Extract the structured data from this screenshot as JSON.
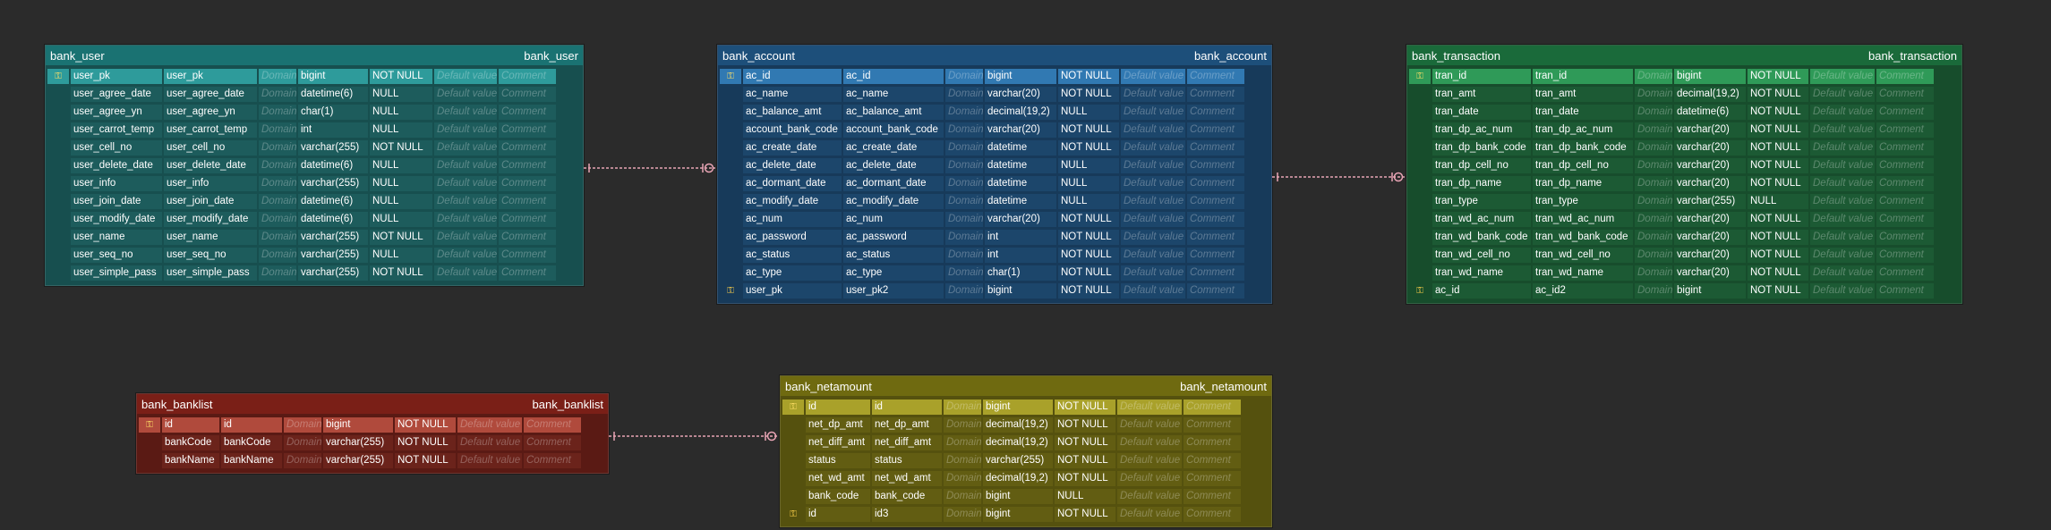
{
  "colors": {
    "background": "#2b2b2b",
    "relationship_line": "#e8a4b4"
  },
  "key_icons": {
    "primary": "⚿",
    "foreign": "⚿"
  },
  "tables": [
    {
      "id": "bank_user",
      "title": "bank_user",
      "title_right": "bank_user",
      "colors": {
        "header": "#1a7272",
        "body": "#174f4f",
        "pk": "#2e9b9b",
        "cell": "#1d5c5c"
      },
      "columns": [
        {
          "key": "pk",
          "name": "user_pk",
          "label": "user_pk",
          "domain": "Domain",
          "type": "bigint",
          "null": "NOT NULL",
          "default": "Default value",
          "comment": "Comment"
        },
        {
          "key": "",
          "name": "user_agree_date",
          "label": "user_agree_date",
          "domain": "Domain",
          "type": "datetime(6)",
          "null": "NULL",
          "default": "Default value",
          "comment": "Comment"
        },
        {
          "key": "",
          "name": "user_agree_yn",
          "label": "user_agree_yn",
          "domain": "Domain",
          "type": "char(1)",
          "null": "NULL",
          "default": "Default value",
          "comment": "Comment"
        },
        {
          "key": "",
          "name": "user_carrot_temp",
          "label": "user_carrot_temp",
          "domain": "Domain",
          "type": "int",
          "null": "NULL",
          "default": "Default value",
          "comment": "Comment"
        },
        {
          "key": "",
          "name": "user_cell_no",
          "label": "user_cell_no",
          "domain": "Domain",
          "type": "varchar(255)",
          "null": "NOT NULL",
          "default": "Default value",
          "comment": "Comment"
        },
        {
          "key": "",
          "name": "user_delete_date",
          "label": "user_delete_date",
          "domain": "Domain",
          "type": "datetime(6)",
          "null": "NULL",
          "default": "Default value",
          "comment": "Comment"
        },
        {
          "key": "",
          "name": "user_info",
          "label": "user_info",
          "domain": "Domain",
          "type": "varchar(255)",
          "null": "NULL",
          "default": "Default value",
          "comment": "Comment"
        },
        {
          "key": "",
          "name": "user_join_date",
          "label": "user_join_date",
          "domain": "Domain",
          "type": "datetime(6)",
          "null": "NULL",
          "default": "Default value",
          "comment": "Comment"
        },
        {
          "key": "",
          "name": "user_modify_date",
          "label": "user_modify_date",
          "domain": "Domain",
          "type": "datetime(6)",
          "null": "NULL",
          "default": "Default value",
          "comment": "Comment"
        },
        {
          "key": "",
          "name": "user_name",
          "label": "user_name",
          "domain": "Domain",
          "type": "varchar(255)",
          "null": "NOT NULL",
          "default": "Default value",
          "comment": "Comment"
        },
        {
          "key": "",
          "name": "user_seq_no",
          "label": "user_seq_no",
          "domain": "Domain",
          "type": "varchar(255)",
          "null": "NULL",
          "default": "Default value",
          "comment": "Comment"
        },
        {
          "key": "",
          "name": "user_simple_pass",
          "label": "user_simple_pass",
          "domain": "Domain",
          "type": "varchar(255)",
          "null": "NOT NULL",
          "default": "Default value",
          "comment": "Comment"
        }
      ]
    },
    {
      "id": "bank_account",
      "title": "bank_account",
      "title_right": "bank_account",
      "colors": {
        "header": "#1d4f7a",
        "body": "#173a5a",
        "pk": "#3179b2",
        "cell": "#1c466b"
      },
      "columns": [
        {
          "key": "pk",
          "name": "ac_id",
          "label": "ac_id",
          "domain": "Domain",
          "type": "bigint",
          "null": "NOT NULL",
          "default": "Default value",
          "comment": "Comment"
        },
        {
          "key": "",
          "name": "ac_name",
          "label": "ac_name",
          "domain": "Domain",
          "type": "varchar(20)",
          "null": "NOT NULL",
          "default": "Default value",
          "comment": "Comment"
        },
        {
          "key": "",
          "name": "ac_balance_amt",
          "label": "ac_balance_amt",
          "domain": "Domain",
          "type": "decimal(19,2)",
          "null": "NULL",
          "default": "Default value",
          "comment": "Comment"
        },
        {
          "key": "",
          "name": "account_bank_code",
          "label": "account_bank_code",
          "domain": "Domain",
          "type": "varchar(20)",
          "null": "NOT NULL",
          "default": "Default value",
          "comment": "Comment"
        },
        {
          "key": "",
          "name": "ac_create_date",
          "label": "ac_create_date",
          "domain": "Domain",
          "type": "datetime",
          "null": "NOT NULL",
          "default": "Default value",
          "comment": "Comment"
        },
        {
          "key": "",
          "name": "ac_delete_date",
          "label": "ac_delete_date",
          "domain": "Domain",
          "type": "datetime",
          "null": "NULL",
          "default": "Default value",
          "comment": "Comment"
        },
        {
          "key": "",
          "name": "ac_dormant_date",
          "label": "ac_dormant_date",
          "domain": "Domain",
          "type": "datetime",
          "null": "NULL",
          "default": "Default value",
          "comment": "Comment"
        },
        {
          "key": "",
          "name": "ac_modify_date",
          "label": "ac_modify_date",
          "domain": "Domain",
          "type": "datetime",
          "null": "NULL",
          "default": "Default value",
          "comment": "Comment"
        },
        {
          "key": "",
          "name": "ac_num",
          "label": "ac_num",
          "domain": "Domain",
          "type": "varchar(20)",
          "null": "NOT NULL",
          "default": "Default value",
          "comment": "Comment"
        },
        {
          "key": "",
          "name": "ac_password",
          "label": "ac_password",
          "domain": "Domain",
          "type": "int",
          "null": "NOT NULL",
          "default": "Default value",
          "comment": "Comment"
        },
        {
          "key": "",
          "name": "ac_status",
          "label": "ac_status",
          "domain": "Domain",
          "type": "int",
          "null": "NOT NULL",
          "default": "Default value",
          "comment": "Comment"
        },
        {
          "key": "",
          "name": "ac_type",
          "label": "ac_type",
          "domain": "Domain",
          "type": "char(1)",
          "null": "NOT NULL",
          "default": "Default value",
          "comment": "Comment"
        },
        {
          "key": "fk",
          "name": "user_pk",
          "label": "user_pk2",
          "domain": "Domain",
          "type": "bigint",
          "null": "NOT NULL",
          "default": "Default value",
          "comment": "Comment"
        }
      ]
    },
    {
      "id": "bank_transaction",
      "title": "bank_transaction",
      "title_right": "bank_transaction",
      "colors": {
        "header": "#1a6a3a",
        "body": "#174d2c",
        "pk": "#2f9a58",
        "cell": "#1c5a34"
      },
      "columns": [
        {
          "key": "pk",
          "name": "tran_id",
          "label": "tran_id",
          "domain": "Domain",
          "type": "bigint",
          "null": "NOT NULL",
          "default": "Default value",
          "comment": "Comment"
        },
        {
          "key": "",
          "name": "tran_amt",
          "label": "tran_amt",
          "domain": "Domain",
          "type": "decimal(19,2)",
          "null": "NOT NULL",
          "default": "Default value",
          "comment": "Comment"
        },
        {
          "key": "",
          "name": "tran_date",
          "label": "tran_date",
          "domain": "Domain",
          "type": "datetime(6)",
          "null": "NOT NULL",
          "default": "Default value",
          "comment": "Comment"
        },
        {
          "key": "",
          "name": "tran_dp_ac_num",
          "label": "tran_dp_ac_num",
          "domain": "Domain",
          "type": "varchar(20)",
          "null": "NOT NULL",
          "default": "Default value",
          "comment": "Comment"
        },
        {
          "key": "",
          "name": "tran_dp_bank_code",
          "label": "tran_dp_bank_code",
          "domain": "Domain",
          "type": "varchar(20)",
          "null": "NOT NULL",
          "default": "Default value",
          "comment": "Comment"
        },
        {
          "key": "",
          "name": "tran_dp_cell_no",
          "label": "tran_dp_cell_no",
          "domain": "Domain",
          "type": "varchar(20)",
          "null": "NOT NULL",
          "default": "Default value",
          "comment": "Comment"
        },
        {
          "key": "",
          "name": "tran_dp_name",
          "label": "tran_dp_name",
          "domain": "Domain",
          "type": "varchar(20)",
          "null": "NOT NULL",
          "default": "Default value",
          "comment": "Comment"
        },
        {
          "key": "",
          "name": "tran_type",
          "label": "tran_type",
          "domain": "Domain",
          "type": "varchar(255)",
          "null": "NULL",
          "default": "Default value",
          "comment": "Comment"
        },
        {
          "key": "",
          "name": "tran_wd_ac_num",
          "label": "tran_wd_ac_num",
          "domain": "Domain",
          "type": "varchar(20)",
          "null": "NOT NULL",
          "default": "Default value",
          "comment": "Comment"
        },
        {
          "key": "",
          "name": "tran_wd_bank_code",
          "label": "tran_wd_bank_code",
          "domain": "Domain",
          "type": "varchar(20)",
          "null": "NOT NULL",
          "default": "Default value",
          "comment": "Comment"
        },
        {
          "key": "",
          "name": "tran_wd_cell_no",
          "label": "tran_wd_cell_no",
          "domain": "Domain",
          "type": "varchar(20)",
          "null": "NOT NULL",
          "default": "Default value",
          "comment": "Comment"
        },
        {
          "key": "",
          "name": "tran_wd_name",
          "label": "tran_wd_name",
          "domain": "Domain",
          "type": "varchar(20)",
          "null": "NOT NULL",
          "default": "Default value",
          "comment": "Comment"
        },
        {
          "key": "fk",
          "name": "ac_id",
          "label": "ac_id2",
          "domain": "Domain",
          "type": "bigint",
          "null": "NOT NULL",
          "default": "Default value",
          "comment": "Comment"
        }
      ]
    },
    {
      "id": "bank_banklist",
      "title": "bank_banklist",
      "title_right": "bank_banklist",
      "colors": {
        "header": "#7a1f17",
        "body": "#5a1a14",
        "pk": "#b04a3c",
        "cell": "#6b231b"
      },
      "columns": [
        {
          "key": "pk",
          "name": "id",
          "label": "id",
          "domain": "Domain",
          "type": "bigint",
          "null": "NOT NULL",
          "default": "Default value",
          "comment": "Comment"
        },
        {
          "key": "",
          "name": "bankCode",
          "label": "bankCode",
          "domain": "Domain",
          "type": "varchar(255)",
          "null": "NOT NULL",
          "default": "Default value",
          "comment": "Comment"
        },
        {
          "key": "",
          "name": "bankName",
          "label": "bankName",
          "domain": "Domain",
          "type": "varchar(255)",
          "null": "NOT NULL",
          "default": "Default value",
          "comment": "Comment"
        }
      ]
    },
    {
      "id": "bank_netamount",
      "title": "bank_netamount",
      "title_right": "bank_netamount",
      "colors": {
        "header": "#6f6a10",
        "body": "#55510e",
        "pk": "#a9a12a",
        "cell": "#625d12"
      },
      "columns": [
        {
          "key": "pk",
          "name": "id",
          "label": "id",
          "domain": "Domain",
          "type": "bigint",
          "null": "NOT NULL",
          "default": "Default value",
          "comment": "Comment"
        },
        {
          "key": "",
          "name": "net_dp_amt",
          "label": "net_dp_amt",
          "domain": "Domain",
          "type": "decimal(19,2)",
          "null": "NOT NULL",
          "default": "Default value",
          "comment": "Comment"
        },
        {
          "key": "",
          "name": "net_diff_amt",
          "label": "net_diff_amt",
          "domain": "Domain",
          "type": "decimal(19,2)",
          "null": "NOT NULL",
          "default": "Default value",
          "comment": "Comment"
        },
        {
          "key": "",
          "name": "status",
          "label": "status",
          "domain": "Domain",
          "type": "varchar(255)",
          "null": "NOT NULL",
          "default": "Default value",
          "comment": "Comment"
        },
        {
          "key": "",
          "name": "net_wd_amt",
          "label": "net_wd_amt",
          "domain": "Domain",
          "type": "decimal(19,2)",
          "null": "NOT NULL",
          "default": "Default value",
          "comment": "Comment"
        },
        {
          "key": "",
          "name": "bank_code",
          "label": "bank_code",
          "domain": "Domain",
          "type": "bigint",
          "null": "NULL",
          "default": "Default value",
          "comment": "Comment"
        },
        {
          "key": "fk",
          "name": "id",
          "label": "id3",
          "domain": "Domain",
          "type": "bigint",
          "null": "NOT NULL",
          "default": "Default value",
          "comment": "Comment"
        }
      ]
    }
  ],
  "relationships": [
    {
      "from": "bank_user",
      "to": "bank_account"
    },
    {
      "from": "bank_account",
      "to": "bank_transaction"
    },
    {
      "from": "bank_banklist",
      "to": "bank_netamount"
    }
  ]
}
